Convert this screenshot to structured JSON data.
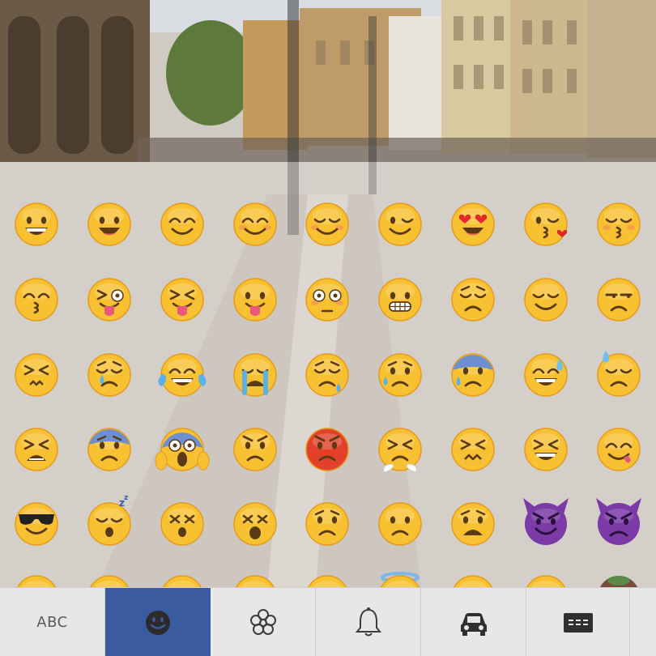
{
  "keyboard": {
    "emoji_rows": [
      [
        "grinning-face",
        "smiling-face-open-mouth",
        "smiling-face",
        "smiling-blushing-face",
        "relieved-smiling-face",
        "winking-face",
        "heart-eyes-face",
        "kissing-heart-face",
        "kissing-closed-eyes-face"
      ],
      [
        "kissing-face",
        "winking-tongue-face",
        "squinting-tongue-face",
        "tongue-out-face",
        "flushed-face",
        "grimacing-face",
        "pensive-face",
        "relieved-face",
        "unamused-face"
      ],
      [
        "persevering-face",
        "crying-face",
        "tears-of-joy-face",
        "loudly-crying-face",
        "sleepy-face",
        "disappointed-relieved-face",
        "fearful-sweat-face",
        "grinning-sweat-face",
        "downcast-sweat-face"
      ],
      [
        "tired-face",
        "fearful-face",
        "screaming-face",
        "angry-face",
        "pouting-face",
        "triumph-face",
        "confounded-face",
        "laughing-squint-face",
        "yum-face"
      ],
      [
        "sunglasses-face",
        "sleeping-face",
        "dizzy-face",
        "astonished-dizzy-face",
        "worried-face",
        "frowning-face",
        "anguished-face",
        "smiling-imp-face",
        "angry-imp-face"
      ],
      [
        "partial-face",
        "partial-face",
        "partial-face",
        "partial-face",
        "partial-face",
        "partial-halo-face",
        "partial-face",
        "partial-face",
        "partial-alien-face"
      ]
    ],
    "colors": {
      "face_yellow": "#f7c131",
      "face_shadow": "#e59a1c",
      "pout_red": "#e2402a",
      "imp_purple": "#7b3aa6",
      "tab_active": "#3a5ba0",
      "tab_bar": "#e7e7e7"
    },
    "tabs": [
      {
        "id": "abc",
        "label": "ABC",
        "icon": "text-label"
      },
      {
        "id": "smileys",
        "label": "",
        "icon": "smiley-icon",
        "active": true
      },
      {
        "id": "nature",
        "label": "",
        "icon": "flower-icon"
      },
      {
        "id": "objects",
        "label": "",
        "icon": "bell-icon"
      },
      {
        "id": "places",
        "label": "",
        "icon": "car-icon"
      },
      {
        "id": "symbols",
        "label": "",
        "icon": "symbols-icon"
      }
    ]
  }
}
